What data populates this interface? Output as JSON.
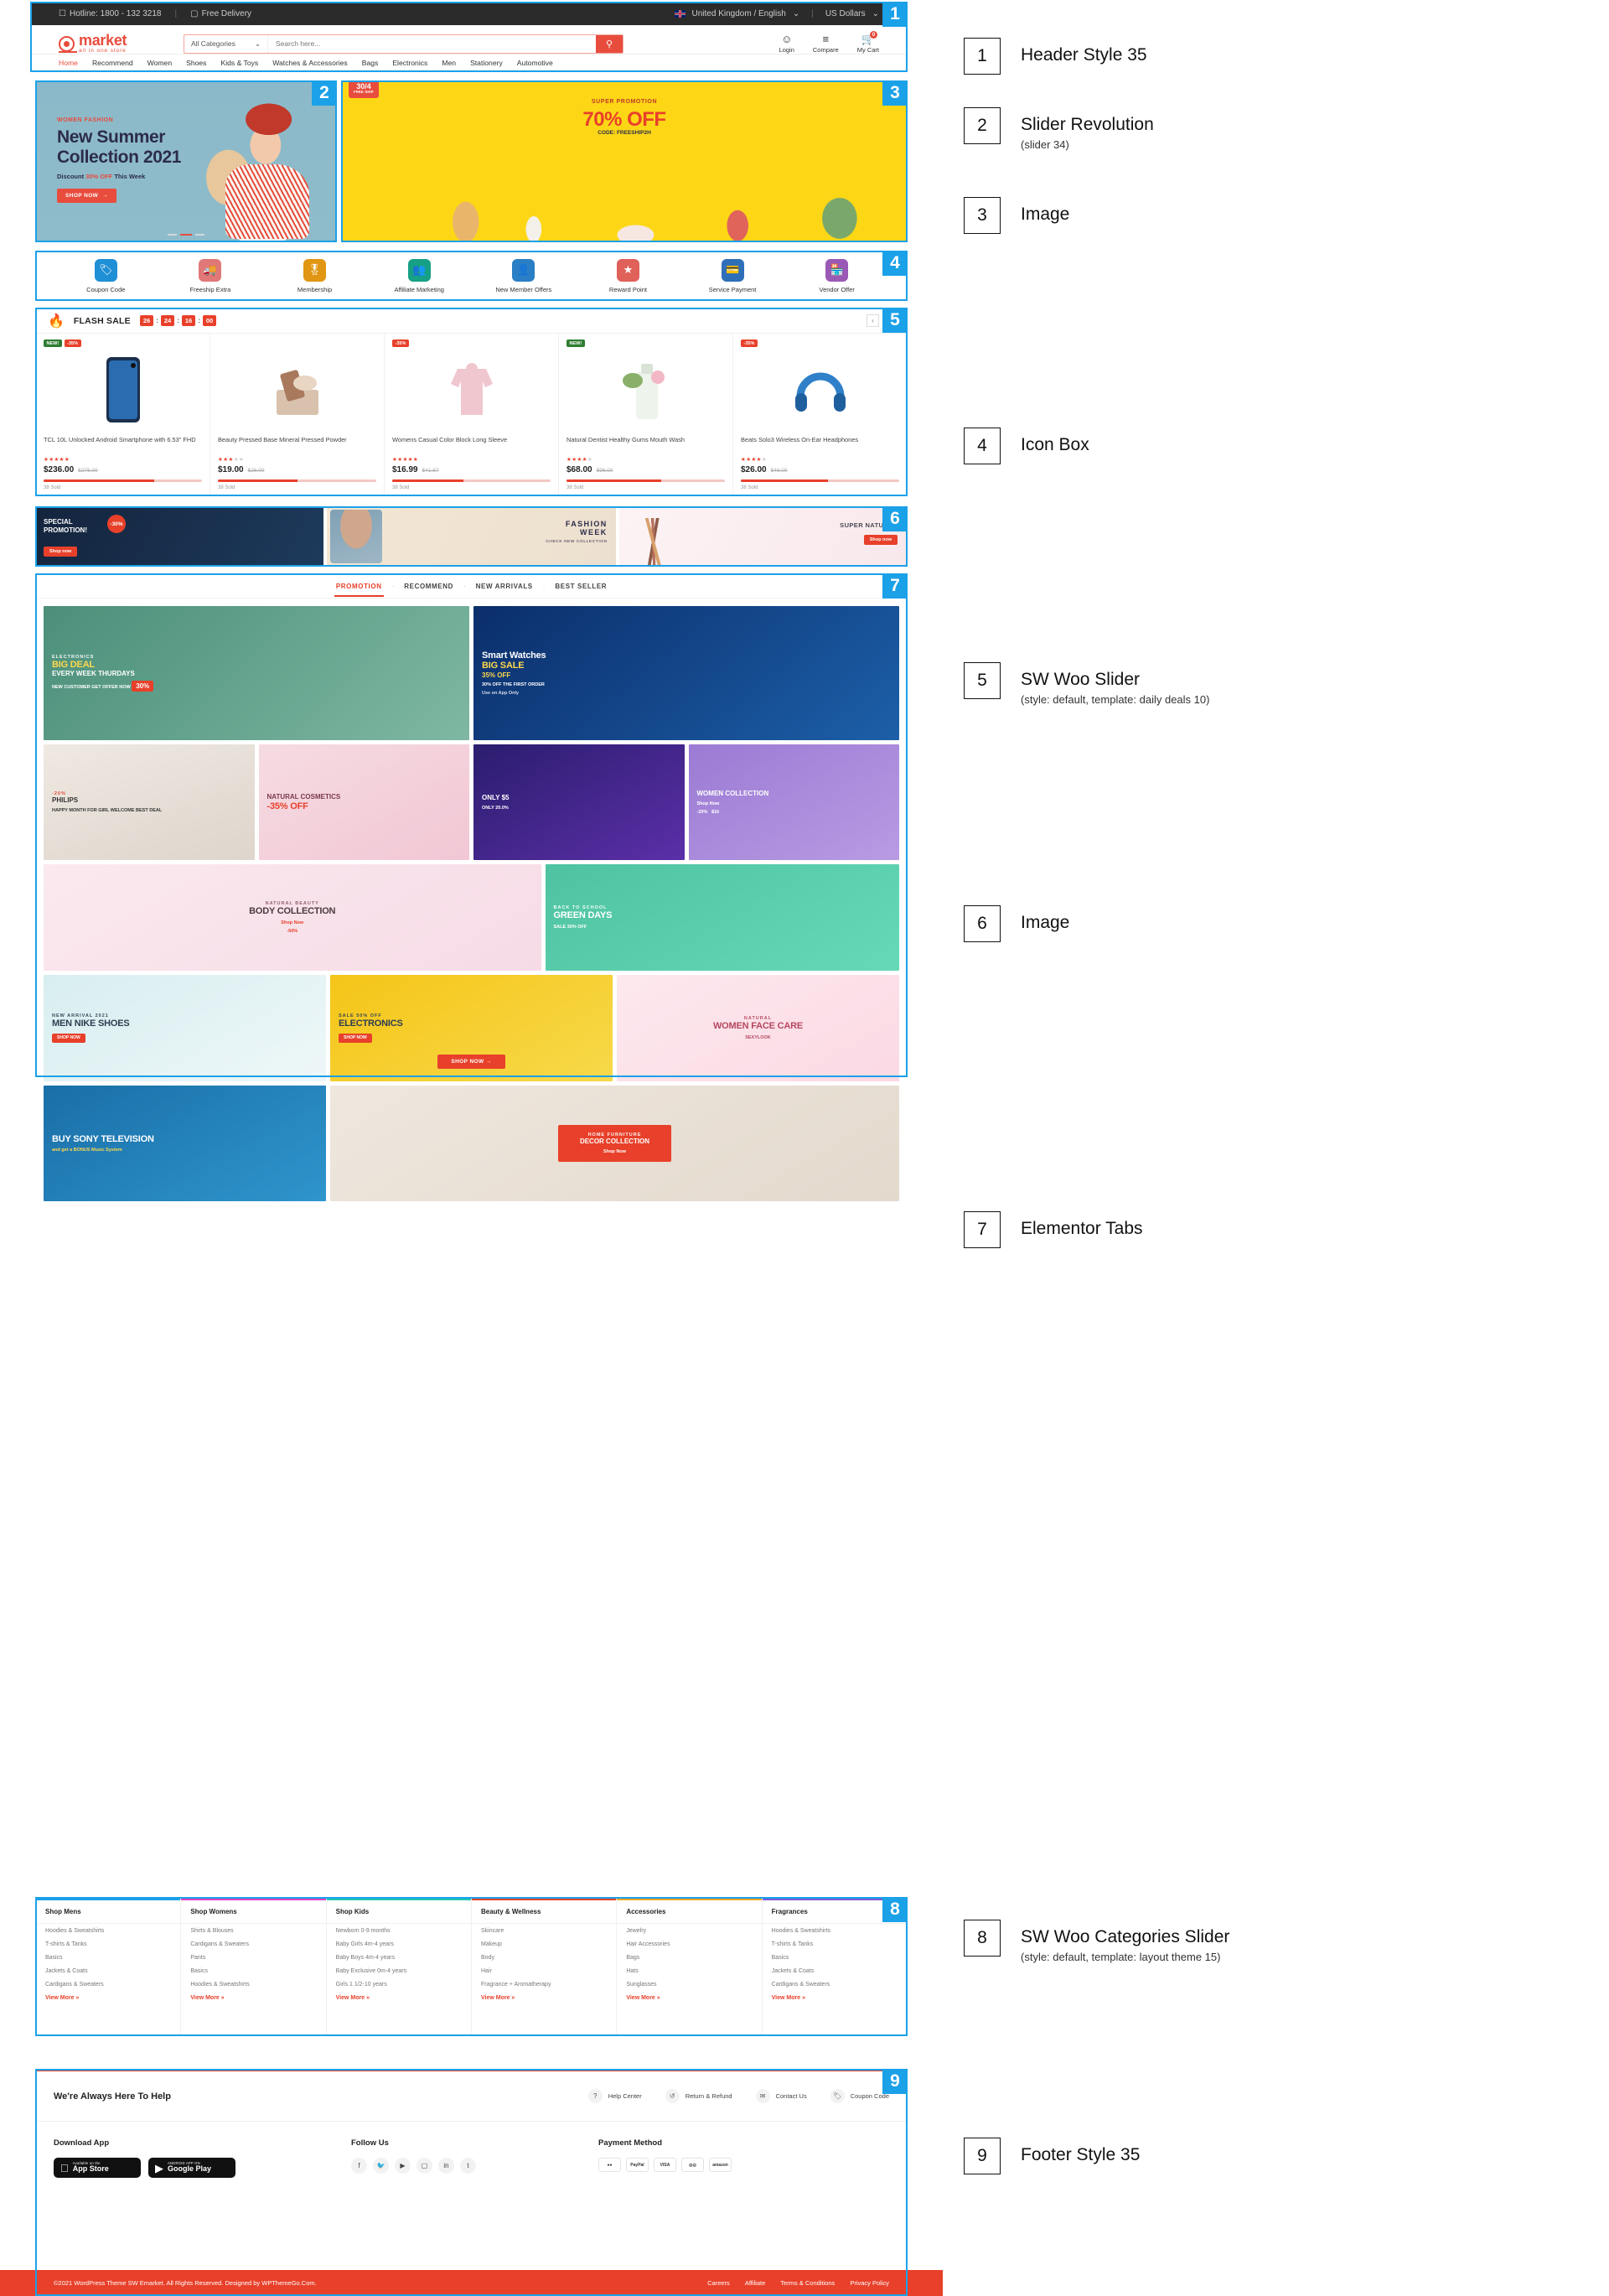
{
  "header": {
    "topbar": {
      "hotline": "Hotline: 1800 - 132 3218",
      "free_delivery": "Free Delivery",
      "language": "United Kingdom / English",
      "currency": "US Dollars"
    },
    "logo": {
      "name": "market",
      "tagline": "all in one store"
    },
    "search": {
      "category": "All Categories",
      "placeholder": "Search here...",
      "icon": "search-icon"
    },
    "actions": [
      {
        "label": "Login",
        "icon": "user-icon"
      },
      {
        "label": "Compare",
        "icon": "compare-icon"
      },
      {
        "label": "My Cart",
        "icon": "cart-icon",
        "count": "0"
      }
    ],
    "nav": [
      {
        "label": "Home",
        "active": true
      },
      {
        "label": "Recommend",
        "active": false
      },
      {
        "label": "Women",
        "active": false
      },
      {
        "label": "Shoes",
        "active": false
      },
      {
        "label": "Kids & Toys",
        "active": false
      },
      {
        "label": "Watches & Accessories",
        "active": false
      },
      {
        "label": "Bags",
        "active": false
      },
      {
        "label": "Electronics",
        "active": false
      },
      {
        "label": "Men",
        "active": false
      },
      {
        "label": "Stationery",
        "active": false
      },
      {
        "label": "Automotive",
        "active": false
      }
    ]
  },
  "hero": {
    "kicker": "WOMEN FASHION",
    "title_line1": "New Summer",
    "title_line2": "Collection 2021",
    "discount_pre": "Discount ",
    "discount_em": "30% OFF",
    "discount_post": " This Week",
    "button": "SHOP NOW"
  },
  "promo": {
    "tag_main": "30/4",
    "tag_sub": "FREE SHIP",
    "line1": "SUPER PROMOTION",
    "line2": "70% OFF",
    "line3": "CODE: FREESHIP2H"
  },
  "iconbox": [
    {
      "label": "Coupon Code",
      "icon": "coupon-tag-icon",
      "color": "#1f8fd6"
    },
    {
      "label": "Freeship Extra",
      "icon": "delivery-truck-icon",
      "color": "#e07878"
    },
    {
      "label": "Membership",
      "icon": "award-badge-icon",
      "color": "#e09612"
    },
    {
      "label": "Affiliate Marketing",
      "icon": "affiliate-people-icon",
      "color": "#16a085"
    },
    {
      "label": "New Member Offers",
      "icon": "new-member-icon",
      "color": "#2b7fc4"
    },
    {
      "label": "Reward Point",
      "icon": "reward-point-icon",
      "color": "#e0605a"
    },
    {
      "label": "Service Payment",
      "icon": "credit-card-icon",
      "color": "#2f6fb8"
    },
    {
      "label": "Vendor Offer",
      "icon": "vendor-store-icon",
      "color": "#9b59b6"
    }
  ],
  "flash_sale": {
    "title": "FLASH SALE",
    "icon": "fire-icon",
    "countdown": [
      "26",
      "24",
      "16",
      "00"
    ],
    "nav_prev": "‹",
    "nav_next": "›",
    "products": [
      {
        "name": "TCL 10L Unlocked Android Smartphone with 6.53\" FHD",
        "price": "$236.00",
        "old_price": "$276.00",
        "stars": 5,
        "sold": "38 Sold",
        "badges": [
          {
            "text": "NEW!",
            "type": "new"
          },
          {
            "text": "-35%",
            "type": "off"
          }
        ],
        "progress": 70
      },
      {
        "name": "Beauty Pressed Base Mineral Pressed Powder",
        "price": "$19.00",
        "old_price": "$26.00",
        "stars": 3,
        "sold": "38 Sold",
        "badges": [],
        "progress": 50
      },
      {
        "name": "Womens Casual Color Block Long Sleeve",
        "price": "$16.99",
        "old_price": "$41.87",
        "stars": 5,
        "sold": "38 Sold",
        "badges": [
          {
            "text": "-35%",
            "type": "off"
          }
        ],
        "progress": 45
      },
      {
        "name": "Natural Dentist Healthy Gums Mouth Wash",
        "price": "$68.00",
        "old_price": "$96.00",
        "stars": 4,
        "sold": "38 Sold",
        "badges": [
          {
            "text": "NEW!",
            "type": "new"
          }
        ],
        "progress": 60
      },
      {
        "name": "Beats Solo3 Wireless On-Ear Headphones",
        "price": "$26.00",
        "old_price": "$48.00",
        "stars": 4,
        "sold": "38 Sold",
        "badges": [
          {
            "text": "-35%",
            "type": "off"
          }
        ],
        "progress": 55
      }
    ]
  },
  "banners": [
    {
      "title_l1": "SPECIAL",
      "title_l2": "PROMOTION!",
      "tag": "-30%",
      "button": "Shop now"
    },
    {
      "l1": "FASHION",
      "l2": "WEEK",
      "l3": "CHECK NEW COLLECTION"
    },
    {
      "title": "SUPER NATURAL",
      "button": "Shop now"
    }
  ],
  "tabs": {
    "items": [
      {
        "label": "PROMOTION",
        "active": true
      },
      {
        "label": "RECOMMEND",
        "active": false
      },
      {
        "label": "NEW ARRIVALS",
        "active": false
      },
      {
        "label": "BEST SELLER",
        "active": false
      }
    ],
    "cells": [
      {
        "kicker": "ELECTRONICS",
        "t1": "BIG DEAL",
        "t2": "EVERY WEEK THURDAYS",
        "sub": "NEW CUSTOMER GET OFFER NOW",
        "pct": "30%"
      },
      {
        "t1": "Smart Watches",
        "t2": "BIG SALE",
        "t3": "35% OFF",
        "sub": "30% OFF THE FIRST ORDER",
        "sub2": "Use on App Only"
      },
      {
        "kicker": "-20%",
        "t1": "PHILIPS",
        "sub": "HAPPY MONTH FOR GIRL WELCOME BEST DEAL"
      },
      {
        "t1": "NATURAL COSMETICS",
        "t2": "-35% OFF"
      },
      {
        "t1": "ONLY $5",
        "sub": "ONLY 20.0%"
      },
      {
        "t1": "WOMEN COLLECTION",
        "sub": "Shop Now",
        "tag1": "-20%",
        "tag2": "$16"
      },
      {
        "kicker": "NATURAL BEAUTY",
        "t1": "BODY COLLECTION",
        "sub": "Shop Now",
        "tag": "-50%"
      },
      {
        "kicker": "BACK TO SCHOOL",
        "t1": "GREEN DAYS",
        "sub": "SALE 30% OFF"
      },
      {
        "kicker": "NEW ARRIVAL 2021",
        "t1": "MEN NIKE SHOES",
        "button": "SHOP NOW"
      },
      {
        "kicker": "SALE 50% OFF",
        "t1": "ELECTRONICS",
        "button": "SHOP NOW"
      },
      {
        "kicker": "NATURAL",
        "t1": "WOMEN FACE CARE",
        "sub": "SEXYLOOK"
      },
      {
        "t1": "BUY SONY TELEVISION",
        "sub": "and get a BONUS Music System"
      },
      {
        "kicker": "HOME FURNITURE",
        "t1": "DECOR COLLECTION",
        "sub": "Shop Now"
      }
    ],
    "shop_now": "SHOP NOW →"
  },
  "categories": [
    {
      "title": "Shop Mens",
      "color": "#1BA1E8",
      "items": [
        "Hoodies & Sweatshirts",
        "T-shirts & Tanks",
        "Basics",
        "Jackets & Coats",
        "Cardigans & Sweaters"
      ],
      "more": "View More  »"
    },
    {
      "title": "Shop Womens",
      "color": "#e040c0",
      "items": [
        "Shirts & Blouses",
        "Cardigans & Sweaters",
        "Pants",
        "Basics",
        "Hoodies & Sweatshirts"
      ],
      "more": "View More  »"
    },
    {
      "title": "Shop Kids",
      "color": "#1ec8b0",
      "items": [
        "Newborn 0-9 months",
        "Baby Girls 4m-4 years",
        "Baby Boys 4m-4 years",
        "Baby Exclusive 0m-4 years",
        "Girls 1 1/2-10 years"
      ],
      "more": "View More  »"
    },
    {
      "title": "Beauty & Wellness",
      "color": "#e8402a",
      "items": [
        "Skincare",
        "Makeup",
        "Body",
        "Hair",
        "Fragrance + Aromatherapy"
      ],
      "more": "View More  »"
    },
    {
      "title": "Accessories",
      "color": "#f5a623",
      "items": [
        "Jewelry",
        "Hair Accessories",
        "Bags",
        "Hats",
        "Sunglasses"
      ],
      "more": "View More  »"
    },
    {
      "title": "Fragrances",
      "color": "#7b5cd6",
      "items": [
        "Hoodies & Sweatshirts",
        "T-shirts & Tanks",
        "Basics",
        "Jackets & Coats",
        "Cardigans & Sweaters"
      ],
      "more": "View More  »"
    }
  ],
  "footer": {
    "help_title": "We're Always Here To Help",
    "help_links": [
      {
        "label": "Help Center",
        "icon": "question-circle-icon"
      },
      {
        "label": "Return & Refund",
        "icon": "return-arrow-icon"
      },
      {
        "label": "Contact Us",
        "icon": "chat-bubble-icon"
      },
      {
        "label": "Coupon Code",
        "icon": "coupon-icon"
      }
    ],
    "download_title": "Download App",
    "stores": [
      {
        "top": "Available on the",
        "name": "App Store",
        "icon": "apple-icon"
      },
      {
        "top": "ANDROID APP ON",
        "name": "Google Play",
        "icon": "google-play-icon"
      }
    ],
    "follow_title": "Follow Us",
    "socials": [
      "facebook-icon",
      "twitter-icon",
      "youtube-icon",
      "instagram-icon",
      "linkedin-icon",
      "tumblr-icon"
    ],
    "payment_title": "Payment Method",
    "payments": [
      "mastercard-icon",
      "paypal-icon",
      "visa-icon",
      "maestro-icon",
      "amazon-icon"
    ],
    "copyright": "©2021 WordPress Theme SW Emarket. All Rights Reserved. Designed by WPThemeGo.Com.",
    "bottom_nav": [
      "Careers",
      "Affiliate",
      "Terms & Conditions",
      "Privacy Policy"
    ]
  },
  "legend": [
    {
      "num": "1",
      "title": "Header Style 35",
      "sub": ""
    },
    {
      "num": "2",
      "title": "Slider Revolution",
      "sub": "(slider 34)"
    },
    {
      "num": "3",
      "title": "Image",
      "sub": ""
    },
    {
      "num": "4",
      "title": "Icon Box",
      "sub": ""
    },
    {
      "num": "5",
      "title": "SW Woo Slider",
      "sub": "(style: default, template: daily deals 10)"
    },
    {
      "num": "6",
      "title": "Image",
      "sub": ""
    },
    {
      "num": "7",
      "title": "Elementor Tabs",
      "sub": ""
    },
    {
      "num": "8",
      "title": "SW Woo Categories Slider",
      "sub": "(style: default, template: layout theme 15)"
    },
    {
      "num": "9",
      "title": "Footer Style 35",
      "sub": ""
    }
  ]
}
